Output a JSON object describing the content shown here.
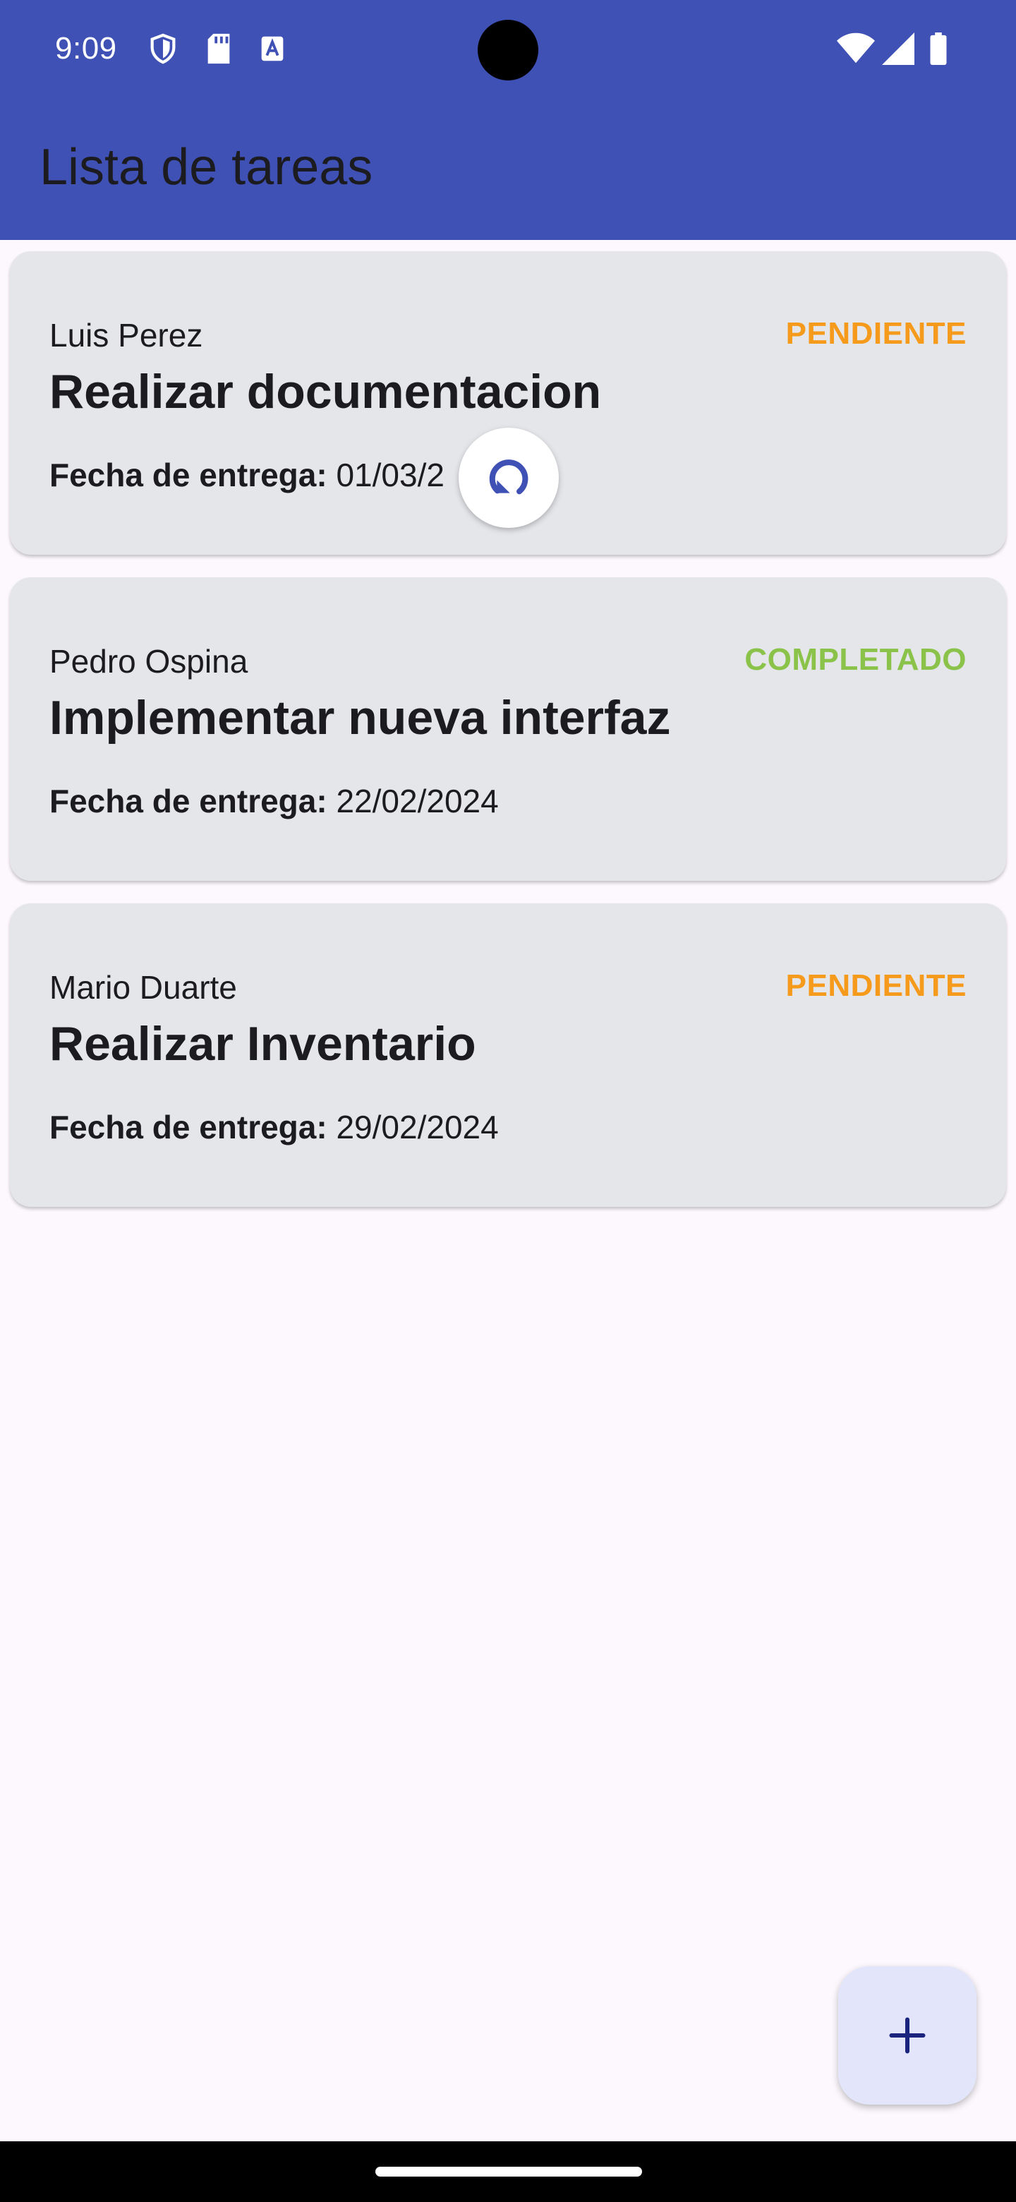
{
  "status_bar": {
    "time": "9:09",
    "icons": [
      "shield-icon",
      "sd-card-icon",
      "text-a-icon",
      "wifi-icon",
      "signal-icon",
      "battery-icon"
    ]
  },
  "app_bar": {
    "title": "Lista de tareas"
  },
  "tasks": [
    {
      "assignee": "Luis Perez",
      "status": "PENDIENTE",
      "status_color": "#f59a1b",
      "title": "Realizar documentacion",
      "due_label": "Fecha de entrega:",
      "due_date": "01/03/2"
    },
    {
      "assignee": "Pedro Ospina",
      "status": "COMPLETADO",
      "status_color": "#8bc34a",
      "title": "Implementar nueva interfaz",
      "due_label": "Fecha de entrega:",
      "due_date": "22/02/2024"
    },
    {
      "assignee": "Mario Duarte",
      "status": "PENDIENTE",
      "status_color": "#f59a1b",
      "title": "Realizar Inventario",
      "due_label": "Fecha de entrega:",
      "due_date": "29/02/2024"
    }
  ],
  "refresh_indicator": {
    "icon": "refresh-icon",
    "color": "#3f51b5"
  },
  "fab": {
    "icon": "plus-icon"
  },
  "colors": {
    "primary": "#3f51b5",
    "card_bg": "#e5e6ea",
    "background": "#fcf8fd",
    "fab_bg": "#e3e6fb",
    "pending": "#f59a1b",
    "completed": "#8bc34a"
  }
}
